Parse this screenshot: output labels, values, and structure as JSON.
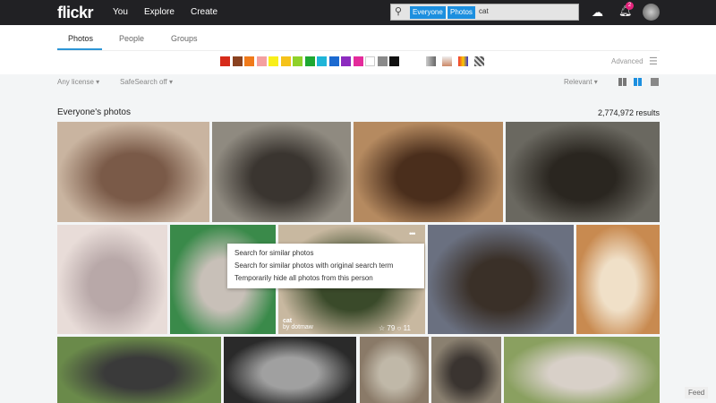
{
  "header": {
    "logo": "flickr",
    "nav": [
      "You",
      "Explore",
      "Create"
    ],
    "search": {
      "scope1": "Everyone",
      "scope2": "Photos",
      "query": "cat"
    },
    "notifications_count": "2"
  },
  "tabs": [
    "Photos",
    "People",
    "Groups"
  ],
  "color_swatches": [
    "#d62b1a",
    "#8a4220",
    "#f07a1a",
    "#f4a0a0",
    "#f8ef1a",
    "#f5c21a",
    "#8fd12a",
    "#1ea832",
    "#1fb5d8",
    "#1c6ad0",
    "#8c2bbf",
    "#e42b9b",
    "#ffffff",
    "#8a8a8a",
    "#111111"
  ],
  "advanced_label": "Advanced",
  "filters": {
    "license": "Any license ▾",
    "safesearch": "SafeSearch off ▾",
    "sort": "Relevant ▾"
  },
  "section_title": "Everyone's photos",
  "results": "2,774,972 results",
  "context_menu": [
    "Search for similar photos",
    "Search for similar photos with original search term",
    "Temporarily hide all photos from this person"
  ],
  "hover_photo": {
    "title": "cat",
    "author": "by dotmaw",
    "faves": "79",
    "comments": "11"
  },
  "feedback": "Feed",
  "accent": "#1c8fdf"
}
